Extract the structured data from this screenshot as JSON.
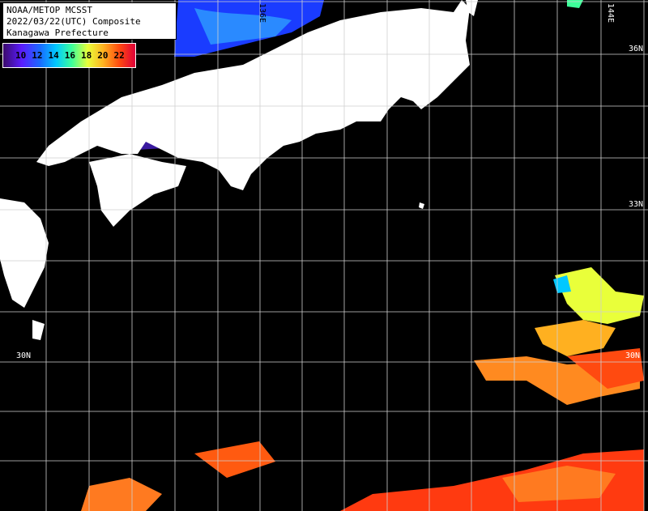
{
  "title": {
    "line1": "NOAA/METOP MCSST",
    "line2": "2022/03/22(UTC) Composite",
    "line3": "Kanagawa Prefecture"
  },
  "legend": {
    "labels": [
      "10",
      "12",
      "14",
      "16",
      "18",
      "20",
      "22"
    ],
    "colors": [
      "#3b0a6b",
      "#5a1cff",
      "#1a6bff",
      "#00c8ff",
      "#3dff9a",
      "#e9ff3a",
      "#ffb020",
      "#ff4a10",
      "#e0003a"
    ]
  },
  "axes": {
    "lon_136": "136E",
    "lon_144": "144E",
    "lat_36": "36N",
    "lat_33": "33N",
    "lat_30_left": "30N",
    "lat_30_right": "30N"
  },
  "colors": {
    "land": "#ffffff",
    "sea_missing": "#000000",
    "grid": "#d0d0d0"
  }
}
